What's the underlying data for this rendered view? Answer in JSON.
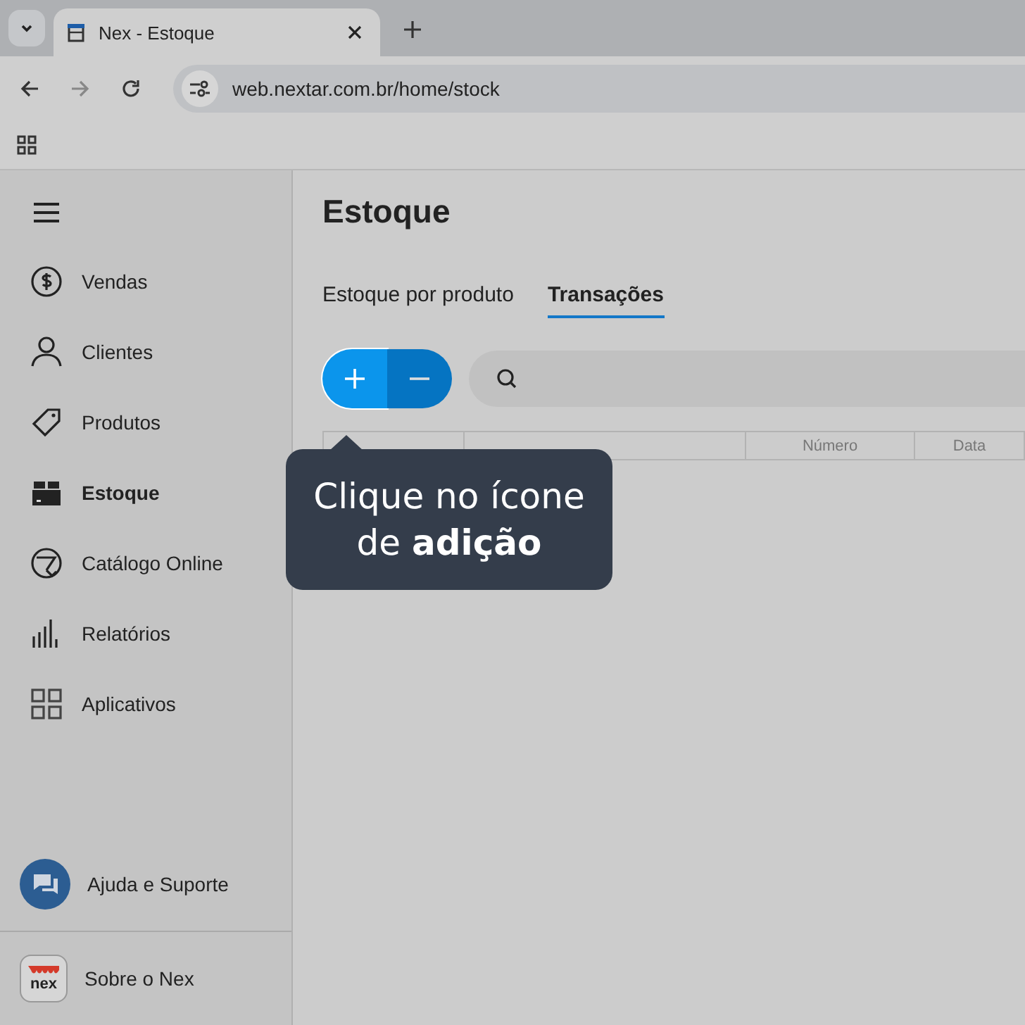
{
  "browser": {
    "tab_title": "Nex - Estoque",
    "url": "web.nextar.com.br/home/stock"
  },
  "sidebar": {
    "items": [
      {
        "label": "Vendas",
        "kind": "dollar",
        "selected": false
      },
      {
        "label": "Clientes",
        "kind": "person",
        "selected": false
      },
      {
        "label": "Produtos",
        "kind": "tag",
        "selected": false
      },
      {
        "label": "Estoque",
        "kind": "box",
        "selected": true
      },
      {
        "label": "Catálogo Online",
        "kind": "catalog",
        "selected": false
      },
      {
        "label": "Relatórios",
        "kind": "bars",
        "selected": false
      },
      {
        "label": "Aplicativos",
        "kind": "grid",
        "selected": false
      }
    ],
    "footer": [
      {
        "label": "Ajuda e Suporte",
        "kind": "help"
      },
      {
        "label": "Sobre o Nex",
        "kind": "about",
        "logo": "nex"
      }
    ]
  },
  "page": {
    "title": "Estoque",
    "tabs": [
      {
        "label": "Estoque por produto",
        "selected": false
      },
      {
        "label": "Transações",
        "selected": true
      }
    ],
    "table": {
      "columns": [
        "Número",
        "Data"
      ]
    }
  },
  "tooltip": {
    "text": "Clique no ícone de **adição**"
  }
}
